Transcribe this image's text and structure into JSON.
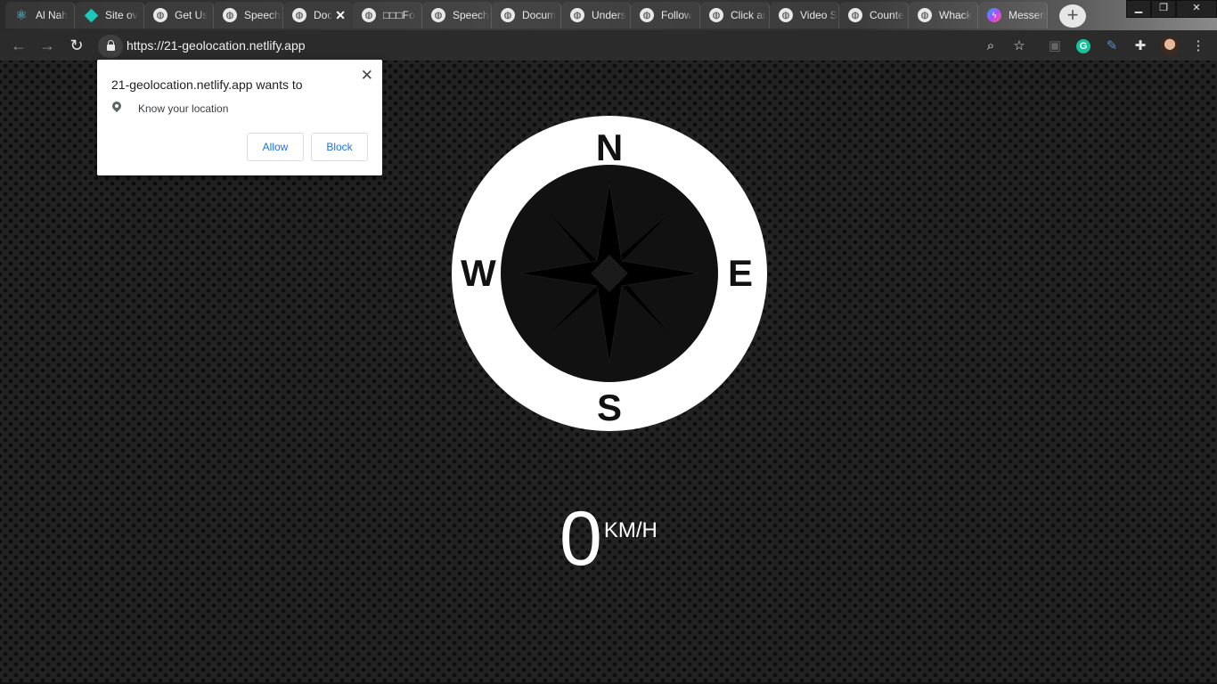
{
  "browser": {
    "tabs": [
      {
        "title": "Al Nah",
        "icon": "react-icon"
      },
      {
        "title": "Site ov",
        "icon": "netlify-icon"
      },
      {
        "title": "Get Us",
        "icon": "globe-icon"
      },
      {
        "title": "Speech",
        "icon": "globe-icon"
      },
      {
        "title": "Doc",
        "icon": "globe-icon",
        "active": true
      },
      {
        "title": "□□□Fo",
        "icon": "globe-icon"
      },
      {
        "title": "Speech",
        "icon": "globe-icon"
      },
      {
        "title": "Docum",
        "icon": "globe-icon"
      },
      {
        "title": "Unders",
        "icon": "globe-icon"
      },
      {
        "title": "Follow",
        "icon": "globe-icon"
      },
      {
        "title": "Click ar",
        "icon": "globe-icon"
      },
      {
        "title": "Video S",
        "icon": "globe-icon"
      },
      {
        "title": "Counte",
        "icon": "globe-icon"
      },
      {
        "title": "Whack",
        "icon": "globe-icon"
      },
      {
        "title": "Messen",
        "icon": "messenger-icon"
      }
    ],
    "address": "https://21-geolocation.netlify.app"
  },
  "permission_prompt": {
    "title": "21-geolocation.netlify.app wants to",
    "permission": "Know your location",
    "allow_label": "Allow",
    "block_label": "Block"
  },
  "compass": {
    "north": "N",
    "south": "S",
    "east": "E",
    "west": "W"
  },
  "speed": {
    "value": "0",
    "unit": "KM/H"
  },
  "colors": {
    "page_bg": "#222222",
    "compass_ring": "#ffffff",
    "link_blue": "#1a73e8"
  }
}
